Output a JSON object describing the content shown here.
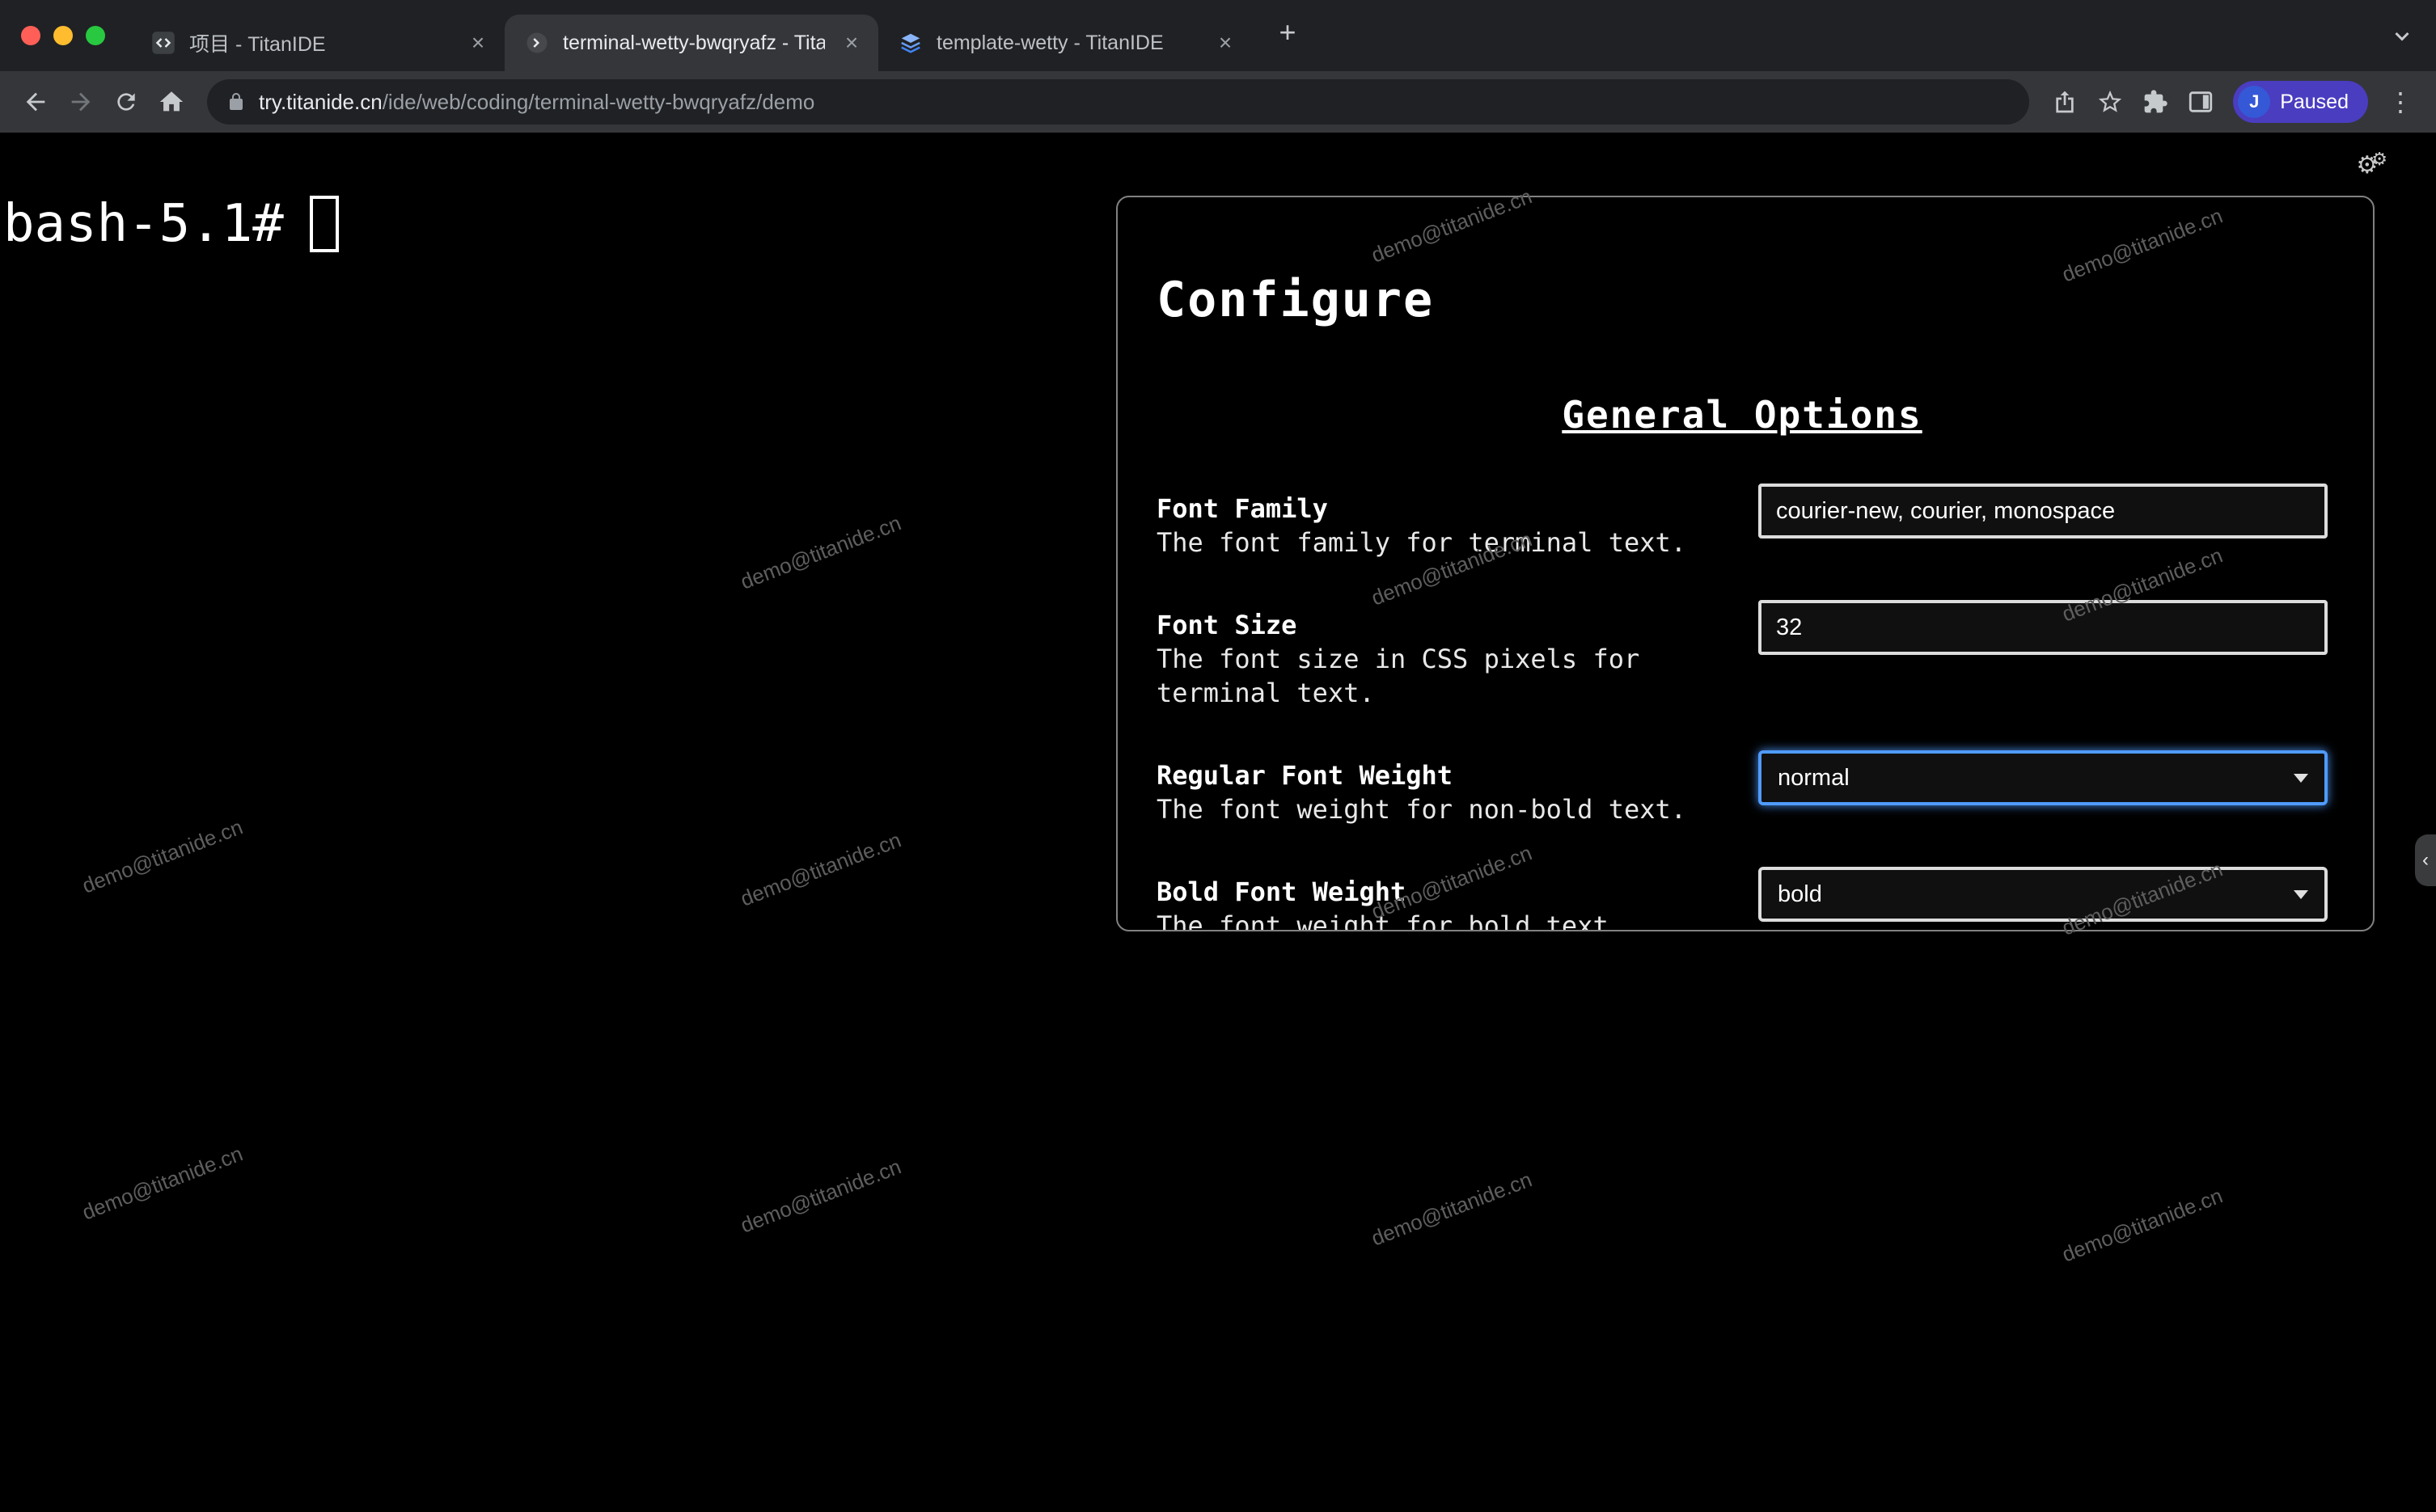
{
  "icons": {
    "close": "×",
    "plus": "+",
    "menu": "⋮",
    "gear": "⚙",
    "collapse": "‹"
  },
  "browser": {
    "tabs": [
      {
        "title": "项目 - TitanIDE"
      },
      {
        "title": "terminal-wetty-bwqryafz - Tita"
      },
      {
        "title": "template-wetty - TitanIDE"
      }
    ],
    "url": {
      "host": "try.titanide.cn",
      "path": "/ide/web/coding/terminal-wetty-bwqryafz/demo"
    },
    "profile": {
      "initial": "J",
      "status": "Paused"
    }
  },
  "terminal": {
    "prompt": "bash-5.1#"
  },
  "watermark": {
    "text": "demo@titanide.cn"
  },
  "configure": {
    "title": "Configure",
    "section_heading": "General Options",
    "fields": [
      {
        "label": "Font Family",
        "description": "The font family for terminal text.",
        "control": "text-input",
        "value": "courier-new, courier, monospace"
      },
      {
        "label": "Font Size",
        "description": "The font size in CSS pixels for terminal text.",
        "control": "text-input",
        "value": "32"
      },
      {
        "label": "Regular Font Weight",
        "description": "The font weight for non-bold text.",
        "control": "select",
        "value": "normal",
        "focused": true
      },
      {
        "label": "Bold Font Weight",
        "description": "The font weight for bold text.",
        "control": "select",
        "value": "bold",
        "focused": false
      }
    ]
  },
  "colors": {
    "focus_ring": "#4f9bff",
    "profile_pill": "#4a3dc0",
    "avatar": "#3558d6",
    "traffic_lights": [
      "#ff5f57",
      "#febc2e",
      "#28c840"
    ]
  }
}
